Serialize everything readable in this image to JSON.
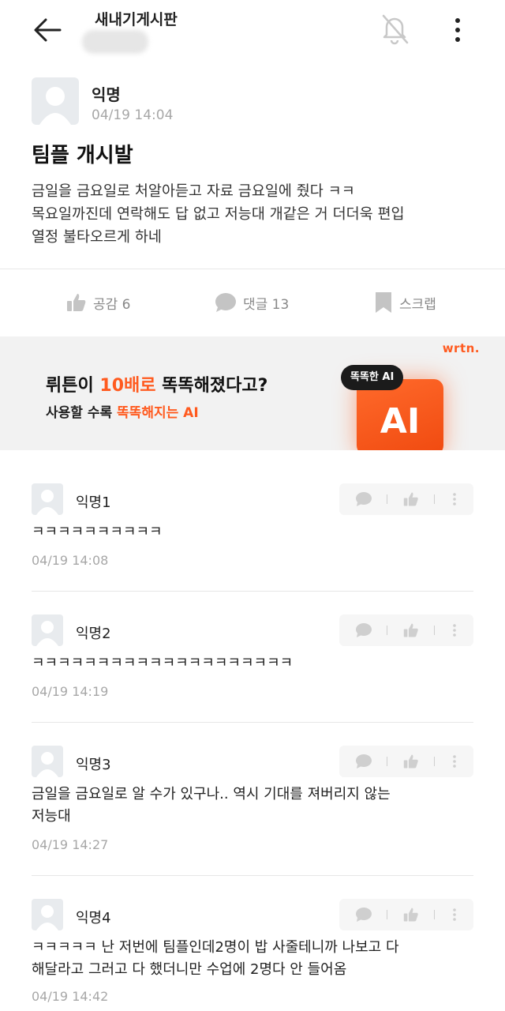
{
  "header": {
    "board_title": "새내기게시판",
    "back_icon": "arrow-left-icon",
    "bell_icon": "bell-off-icon",
    "more_icon": "more-vertical-icon"
  },
  "post": {
    "author": "익명",
    "time": "04/19 14:04",
    "title": "팀플 개시발",
    "body": "금일을 금요일로 처알아듣고 자료 금요일에 줬다 ㅋㅋ\n목요일까진데 연락해도 답 없고 저능대 개같은 거 더더욱 편입\n열정 불타오르게 하네"
  },
  "actions": {
    "like_label": "공감 6",
    "comment_label": "댓글 13",
    "scrap_label": "스크랩"
  },
  "ad": {
    "logo": "wrtn.",
    "headline_prefix": "뤼튼이 ",
    "headline_accent": "10배로",
    "headline_suffix": " 똑똑해졌다고?",
    "sub_prefix": "사용할 수록 ",
    "sub_accent": "똑똑해지는 AI",
    "badge": "똑똑한 AI",
    "ai_text": "AI",
    "accent_color": "#ff5a1f"
  },
  "comments": [
    {
      "author": "익명1",
      "text": "ㅋㅋㅋㅋㅋㅋㅋㅋㅋㅋ",
      "time": "04/19 14:08"
    },
    {
      "author": "익명2",
      "text": "ㅋㅋㅋㅋㅋㅋㅋㅋㅋㅋㅋㅋㅋㅋㅋㅋㅋㅋㅋㅋ",
      "time": "04/19 14:19"
    },
    {
      "author": "익명3",
      "text": "금일을 금요일로 알 수가 있구나.. 역시 기대를 져버리지 않는\n저능대",
      "time": "04/19 14:27"
    },
    {
      "author": "익명4",
      "text": "ㅋㅋㅋㅋㅋ 난 저번에 팀플인데2명이 밥 사줄테니까 나보고 다\n해달라고 그러고 다 했더니만 수업에 2명다 안 들어옴",
      "time": "04/19 14:42"
    }
  ]
}
